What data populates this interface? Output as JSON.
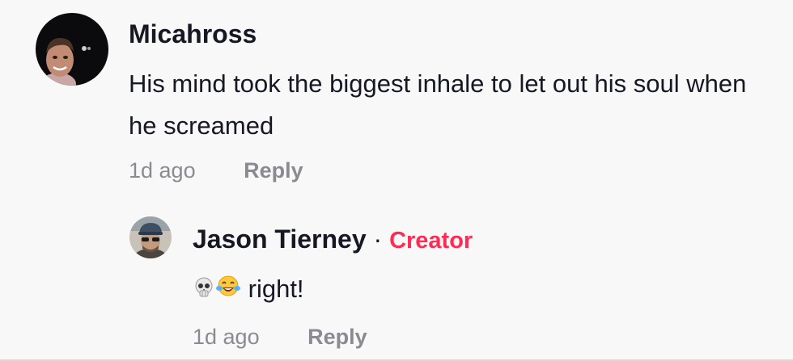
{
  "comments": [
    {
      "author": "Micahross",
      "text": "His mind took the biggest inhale to let out his soul when he screamed",
      "timestamp": "1d ago",
      "reply_label": "Reply",
      "avatar_icon": "user-avatar-photo"
    }
  ],
  "replies": [
    {
      "author": "Jason Tierney",
      "separator": "·",
      "badge": "Creator",
      "emojis": [
        "skull-emoji",
        "tears-of-joy-emoji"
      ],
      "text": "right!",
      "timestamp": "1d ago",
      "reply_label": "Reply",
      "avatar_icon": "user-avatar-photo"
    }
  ],
  "colors": {
    "background": "#f8f8f8",
    "primary_text": "#161823",
    "secondary_text": "#8a8b91",
    "creator_accent": "#fe2c55"
  }
}
